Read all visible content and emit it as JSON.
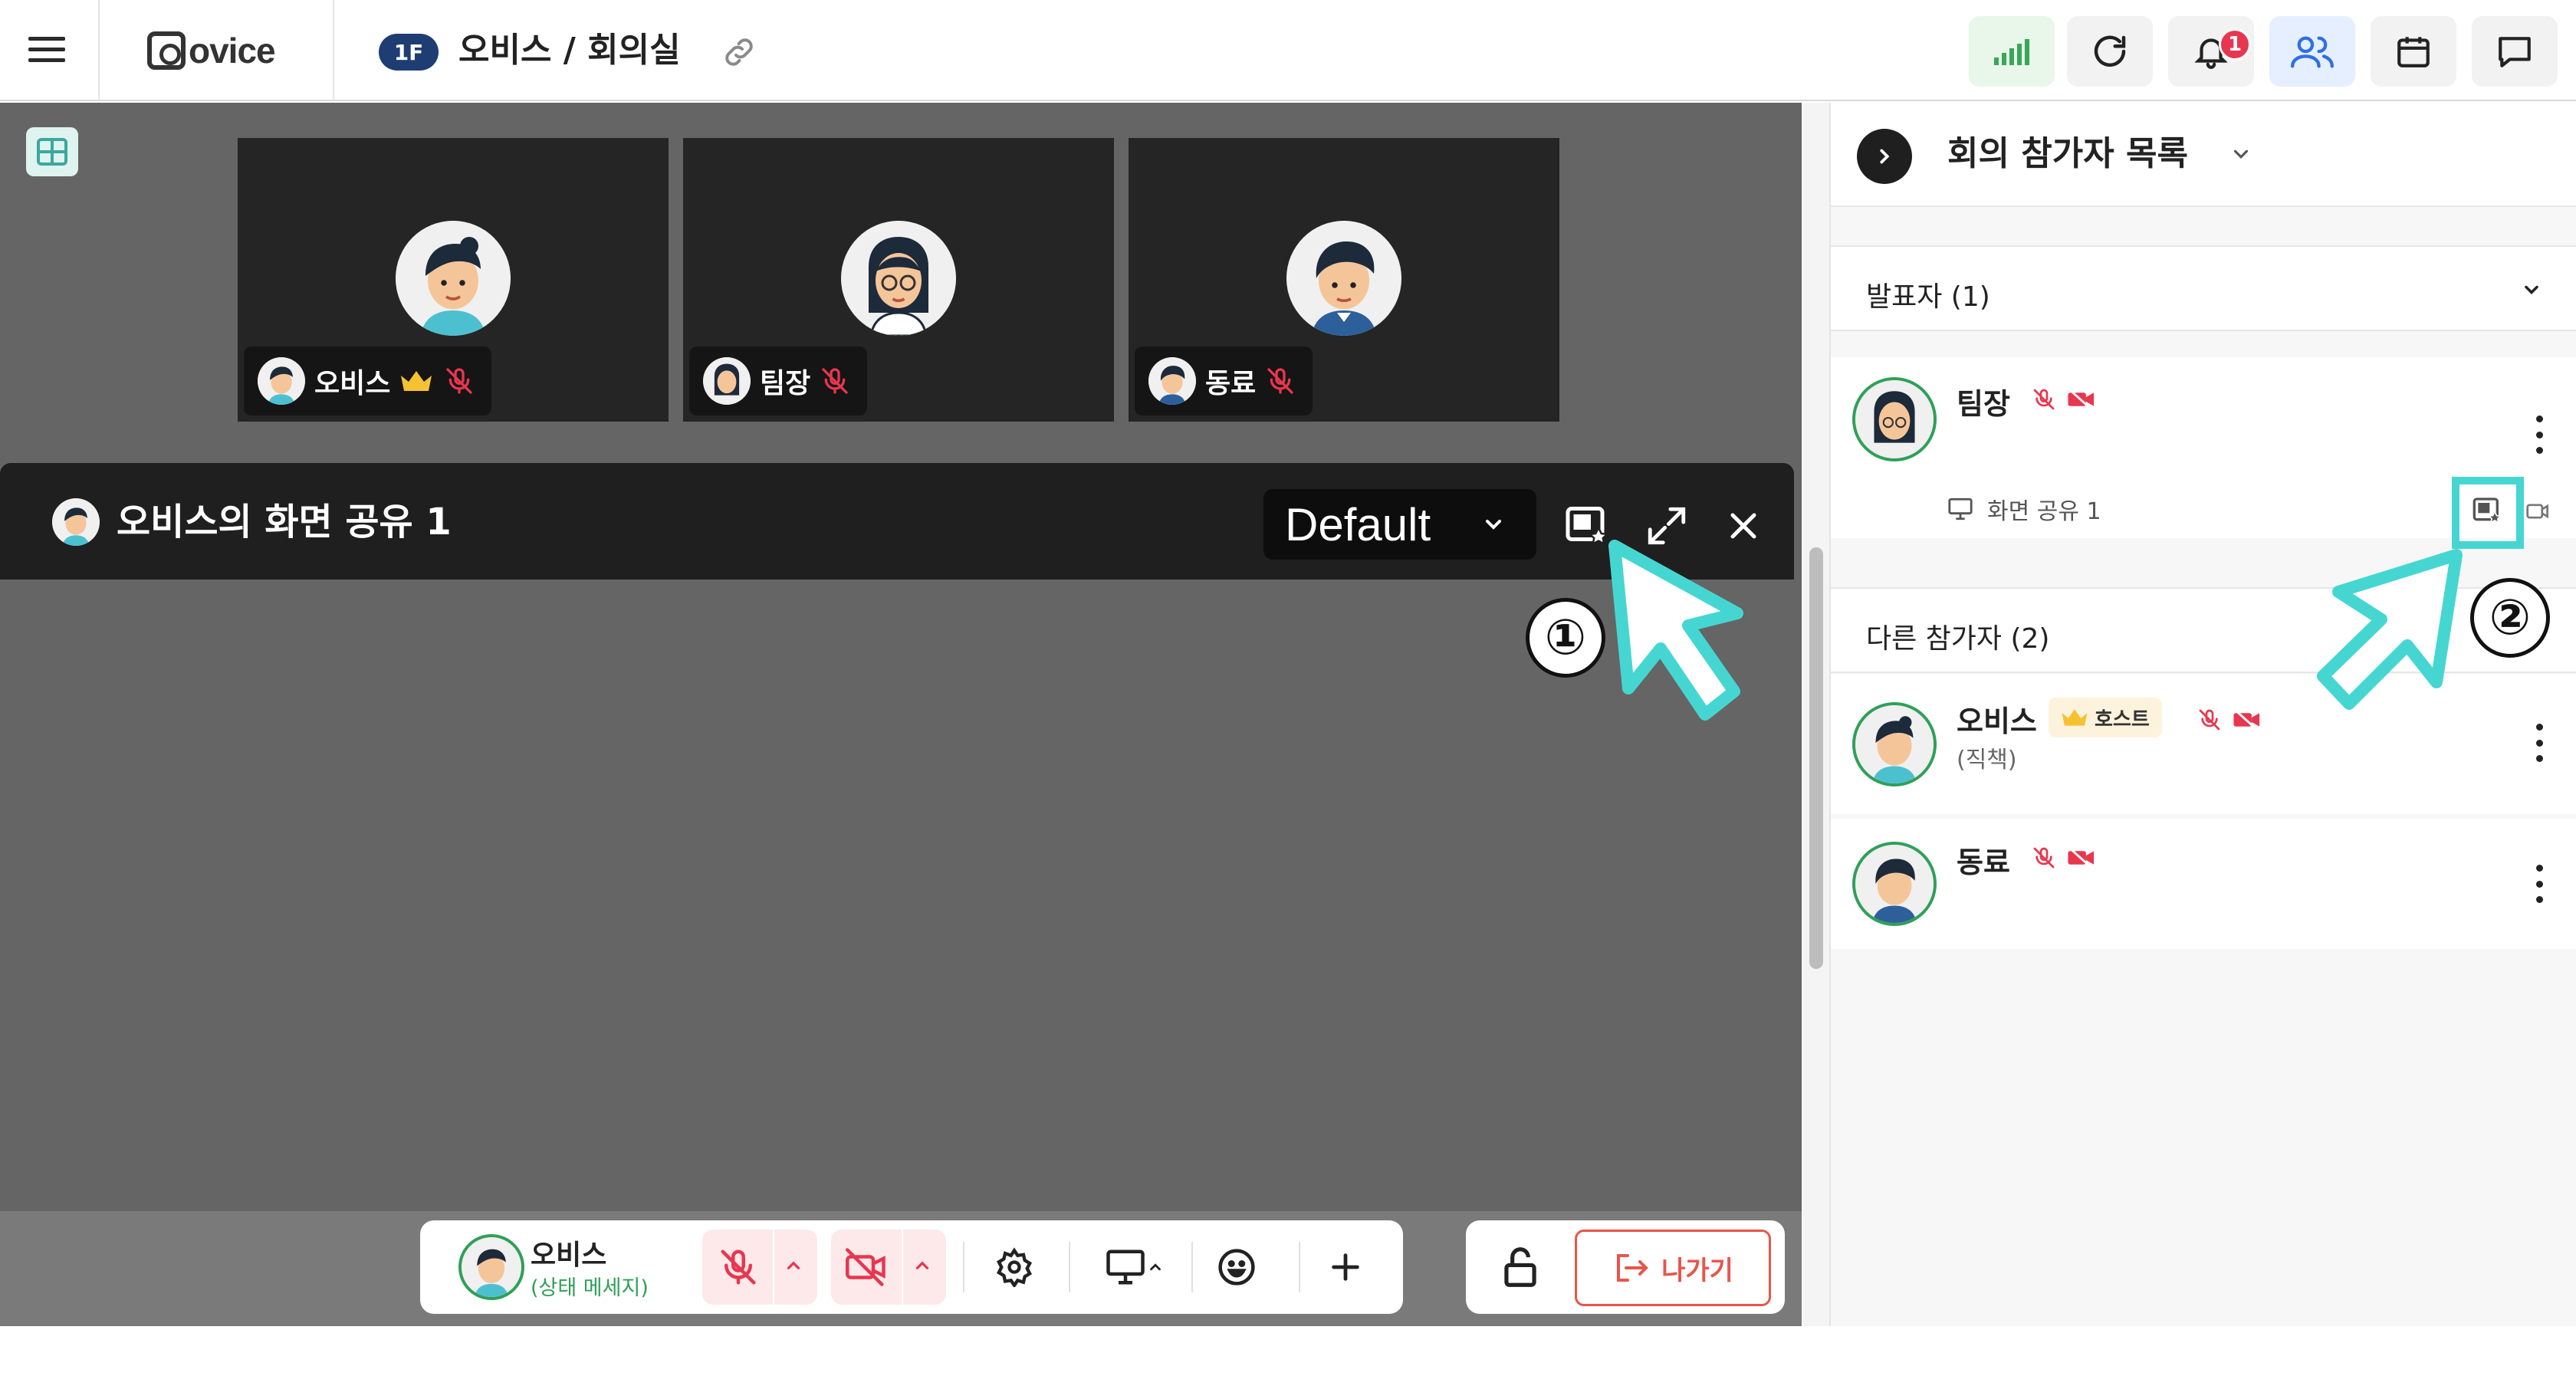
{
  "header": {
    "logo_text": "ovice",
    "floor_badge": "1F",
    "room_title": "오비스 / 회의실",
    "notification_count": "1"
  },
  "video_tiles": [
    {
      "name": "오비스",
      "host": true,
      "muted": true
    },
    {
      "name": "팀장",
      "host": false,
      "muted": true
    },
    {
      "name": "동료",
      "host": false,
      "muted": true
    }
  ],
  "screen_share": {
    "title": "오비스의 화면 공유 1",
    "layout_value": "Default"
  },
  "toolbar": {
    "user_name": "오비스",
    "status_message": "(상태 메세지)",
    "exit_label": "나가기"
  },
  "sidebar": {
    "title": "회의 참가자 목록",
    "presenters_heading": "발표자 (1)",
    "presenter": {
      "name": "팀장",
      "share_label": "화면 공유 1"
    },
    "others_heading": "다른 참가자 (2)",
    "others": [
      {
        "name": "오비스",
        "badge": "호스트",
        "role": "(직책)"
      },
      {
        "name": "동료"
      }
    ]
  },
  "callouts": [
    "①",
    "②"
  ],
  "colors": {
    "accent_teal": "#46d6d2",
    "mute_red": "#e8364f",
    "host_green": "#2fa058",
    "floor_navy": "#1e3d73"
  }
}
